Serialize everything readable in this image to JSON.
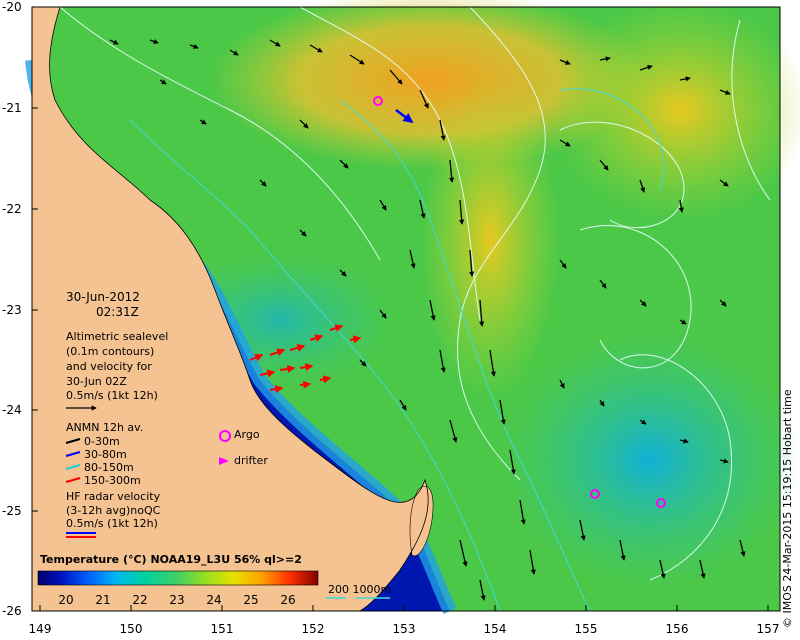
{
  "map": {
    "y_ticks": [
      "-20",
      "-21",
      "-22",
      "-23",
      "-24",
      "-25",
      "-26"
    ],
    "x_ticks": [
      "149",
      "150",
      "151",
      "152",
      "153",
      "154",
      "155",
      "156",
      "157"
    ],
    "date": "30-Jun-2012",
    "time": "02:31Z",
    "altimetry": {
      "line1": "Altimetric sealevel",
      "line2": "(0.1m contours)",
      "line3": "and velocity for",
      "line4": "30-Jun 02Z",
      "scale": "0.5m/s (1kt 12h)"
    },
    "anmn": {
      "title": "ANMN 12h av.",
      "items": [
        "0-30m",
        "30-80m",
        "80-150m",
        "150-300m"
      ],
      "colors": [
        "#000000",
        "#0000ff",
        "#20d0d0",
        "#ff0000"
      ]
    },
    "markers": {
      "argo": "Argo",
      "drifter": "drifter"
    },
    "hf_radar": {
      "line1": "HF radar velocity",
      "line2": "(3-12h avg)noQC",
      "scale": "0.5m/s (1kt 12h)"
    },
    "colorbar": {
      "title": "Temperature (°C)",
      "dataset": "NOAA19_L3U 56% ql>=2",
      "labels": [
        "20",
        "21",
        "22",
        "23",
        "24",
        "25",
        "26"
      ]
    },
    "bathymetry": {
      "label": "200  1000m"
    },
    "credit": "© IMOS 24-Mar-2015 15:19:15 Hobart time",
    "colors": {
      "land": "#f5c392",
      "coastal_cold": "#000c8f",
      "accent_magenta": "#ff00ff",
      "contour_cyan": "#40d8d8",
      "contour_white": "#e8ffff"
    }
  }
}
